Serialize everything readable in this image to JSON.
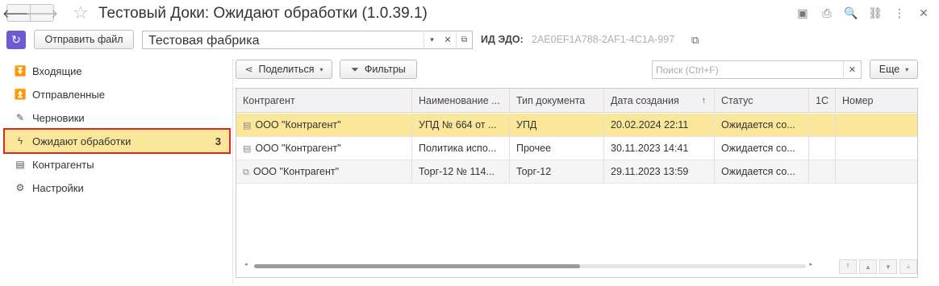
{
  "window": {
    "title": "Тестовый Доки: Ожидают обработки (1.0.39.1)",
    "back_glyph": "🡐",
    "forward_glyph": "🡒",
    "star_glyph": "☆",
    "icons": [
      "save-icon",
      "print-icon",
      "search-icon",
      "link-icon",
      "more-icon",
      "close-icon"
    ],
    "icon_glyphs": [
      "▣",
      "⎙",
      "🔍",
      "⛓",
      "⋮",
      "✕"
    ]
  },
  "toolbar": {
    "refresh_glyph": "↻",
    "send_file_label": "Отправить файл",
    "organization": "Тестовая фабрика",
    "dropdown_glyph": "▾",
    "clear_glyph": "✕",
    "open_glyph": "⧉",
    "edo_label": "ИД ЭДО:",
    "edo_value": "2AE0EF1A788-2AF1-4C1A-997",
    "copy_glyph": "⧉"
  },
  "sidebar": {
    "items": [
      {
        "label": "Входящие",
        "icon": "inbox-icon",
        "glyph": "⏬"
      },
      {
        "label": "Отправленные",
        "icon": "outbox-icon",
        "glyph": "⏫"
      },
      {
        "label": "Черновики",
        "icon": "pencil-icon",
        "glyph": "✎"
      },
      {
        "label": "Ожидают обработки",
        "icon": "lightning-icon",
        "glyph": "ϟ",
        "count": "3",
        "active": true
      },
      {
        "label": "Контрагенты",
        "icon": "contacts-icon",
        "glyph": "▤"
      },
      {
        "label": "Настройки",
        "icon": "gear-icon",
        "glyph": "⚙"
      }
    ]
  },
  "list_toolbar": {
    "share_label": "Поделиться",
    "share_glyph": "⋖",
    "filters_label": "Фильтры",
    "filter_glyph": "⏷",
    "caret_glyph": "▾",
    "search_placeholder": "Поиск (Ctrl+F)",
    "search_clear_glyph": "✕",
    "more_label": "Еще"
  },
  "table": {
    "columns": [
      "Контрагент",
      "Наименование ...",
      "Тип документа",
      "Дата создания",
      "Статус",
      "1С",
      "Номер"
    ],
    "sort_glyph": "↑",
    "rows": [
      {
        "counterparty": "ООО \"Контрагент\"",
        "name": "УПД № 664 от ...",
        "type": "УПД",
        "created": "20.02.2024 22:11",
        "status": "Ожидается со...",
        "c1": "",
        "number": "",
        "icon": "document-icon",
        "glyph": "▤"
      },
      {
        "counterparty": "ООО \"Контрагент\"",
        "name": "Политика испо...",
        "type": "Прочее",
        "created": "30.11.2023 14:41",
        "status": "Ожидается со...",
        "c1": "",
        "number": "",
        "icon": "document-icon",
        "glyph": "▤"
      },
      {
        "counterparty": "ООО \"Контрагент\"",
        "name": "Торг-12 № 114...",
        "type": "Торг-12",
        "created": "29.11.2023 13:59",
        "status": "Ожидается со...",
        "c1": "",
        "number": "",
        "icon": "document-stack-icon",
        "glyph": "⧉"
      }
    ]
  },
  "scroll": {
    "left_glyph": "◂",
    "right_glyph": "▸",
    "nav_glyphs": [
      "⤒",
      "▲",
      "▼",
      "⤓"
    ]
  },
  "colors": {
    "accent": "#6e5bd0",
    "selection": "#fbe79a",
    "highlight_border": "#e1261b"
  }
}
